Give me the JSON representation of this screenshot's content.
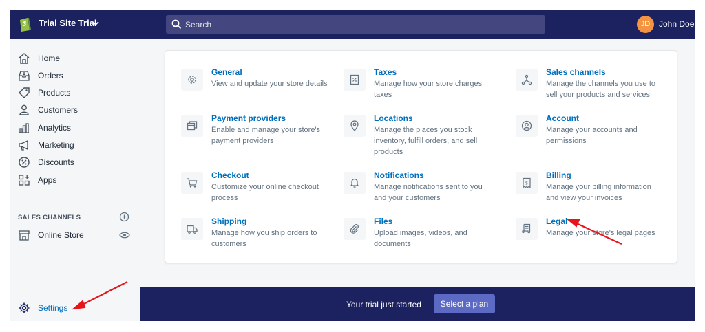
{
  "topbar": {
    "store_name": "Trial Site Trial",
    "search_placeholder": "Search",
    "user_initials": "JD",
    "user_name": "John Doe"
  },
  "sidebar": {
    "items": [
      {
        "label": "Home",
        "icon": "home-icon"
      },
      {
        "label": "Orders",
        "icon": "orders-icon"
      },
      {
        "label": "Products",
        "icon": "tag-icon"
      },
      {
        "label": "Customers",
        "icon": "person-icon"
      },
      {
        "label": "Analytics",
        "icon": "bar-chart-icon"
      },
      {
        "label": "Marketing",
        "icon": "megaphone-icon"
      },
      {
        "label": "Discounts",
        "icon": "discount-icon"
      },
      {
        "label": "Apps",
        "icon": "apps-icon"
      }
    ],
    "sales_channels_heading": "SALES CHANNELS",
    "online_store_label": "Online Store",
    "settings_label": "Settings"
  },
  "settings": [
    {
      "title": "General",
      "desc": "View and update your store details",
      "icon": "gear-icon"
    },
    {
      "title": "Taxes",
      "desc": "Manage how your store charges taxes",
      "icon": "receipt-icon"
    },
    {
      "title": "Sales channels",
      "desc": "Manage the channels you use to sell your products and services",
      "icon": "channels-icon"
    },
    {
      "title": "Payment providers",
      "desc": "Enable and manage your store's payment providers",
      "icon": "payment-icon"
    },
    {
      "title": "Locations",
      "desc": "Manage the places you stock inventory, fulfill orders, and sell products",
      "icon": "location-pin-icon"
    },
    {
      "title": "Account",
      "desc": "Manage your accounts and permissions",
      "icon": "account-icon"
    },
    {
      "title": "Checkout",
      "desc": "Customize your online checkout process",
      "icon": "cart-icon"
    },
    {
      "title": "Notifications",
      "desc": "Manage notifications sent to you and your customers",
      "icon": "bell-icon"
    },
    {
      "title": "Billing",
      "desc": "Manage your billing information and view your invoices",
      "icon": "billing-icon"
    },
    {
      "title": "Shipping",
      "desc": "Manage how you ship orders to customers",
      "icon": "truck-icon"
    },
    {
      "title": "Files",
      "desc": "Upload images, videos, and documents",
      "icon": "paperclip-icon"
    },
    {
      "title": "Legal",
      "desc": "Manage your store's legal pages",
      "icon": "legal-document-icon"
    }
  ],
  "trial_bar": {
    "text": "Your trial just started",
    "button": "Select a plan"
  },
  "colors": {
    "topbar": "#1c2260",
    "link": "#006fbb",
    "accent_button": "#5c6ac4",
    "annotation_arrow": "#e8141b"
  }
}
